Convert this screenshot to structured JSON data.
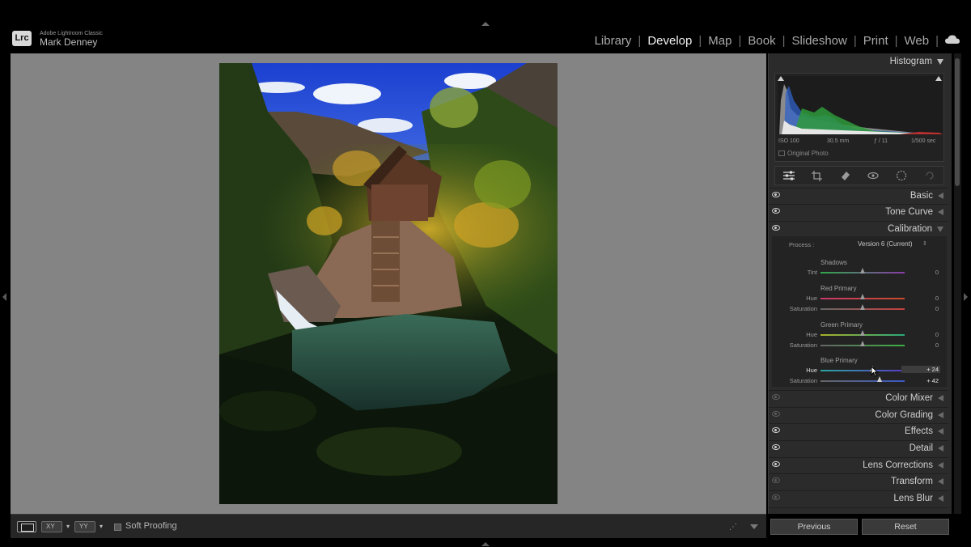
{
  "app": {
    "logo": "Lrc",
    "name": "Adobe Lightroom Classic",
    "user": "Mark Denney"
  },
  "modules": [
    {
      "label": "Library",
      "active": false
    },
    {
      "label": "Develop",
      "active": true
    },
    {
      "label": "Map",
      "active": false
    },
    {
      "label": "Book",
      "active": false
    },
    {
      "label": "Slideshow",
      "active": false
    },
    {
      "label": "Print",
      "active": false
    },
    {
      "label": "Web",
      "active": false
    }
  ],
  "histogram": {
    "title": "Histogram",
    "iso": "ISO 100",
    "focal": "30.5 mm",
    "aperture": "ƒ / 11",
    "shutter": "1/500 sec",
    "original_photo": "Original Photo"
  },
  "tools": [
    "sliders-icon",
    "crop-icon",
    "eraser-icon",
    "redeye-icon",
    "mask-icon",
    "reset-icon"
  ],
  "panels": {
    "basic": "Basic",
    "tone_curve": "Tone Curve",
    "calibration": "Calibration",
    "color_mixer": "Color Mixer",
    "color_grading": "Color Grading",
    "effects": "Effects",
    "detail": "Detail",
    "lens_corrections": "Lens Corrections",
    "transform": "Transform",
    "lens_blur": "Lens Blur"
  },
  "calibration": {
    "process_label": "Process :",
    "process_value": "Version 6 (Current)",
    "process_arrows": "⇕",
    "groups": {
      "shadows": "Shadows",
      "red": "Red Primary",
      "green": "Green Primary",
      "blue": "Blue Primary"
    },
    "sliders": {
      "shadows_tint": {
        "label": "Tint",
        "value": "0",
        "level": 0.5
      },
      "red_hue": {
        "label": "Hue",
        "value": "0",
        "level": 0.5
      },
      "red_sat": {
        "label": "Saturation",
        "value": "0",
        "level": 0.5
      },
      "green_hue": {
        "label": "Hue",
        "value": "0",
        "level": 0.5
      },
      "green_sat": {
        "label": "Saturation",
        "value": "0",
        "level": 0.5
      },
      "blue_hue": {
        "label": "Hue",
        "value": "+ 24",
        "level": 0.62
      },
      "blue_sat": {
        "label": "Saturation",
        "value": "+ 42",
        "level": 0.71
      }
    }
  },
  "toolbar": {
    "soft_proofing": "Soft Proofing",
    "compare": "XY",
    "survey": "YY"
  },
  "buttons": {
    "previous": "Previous",
    "reset": "Reset"
  },
  "colors": {
    "panel_bg": "#2b2b2b",
    "view_bg": "#848484",
    "active_module": "#f2f2f2"
  }
}
